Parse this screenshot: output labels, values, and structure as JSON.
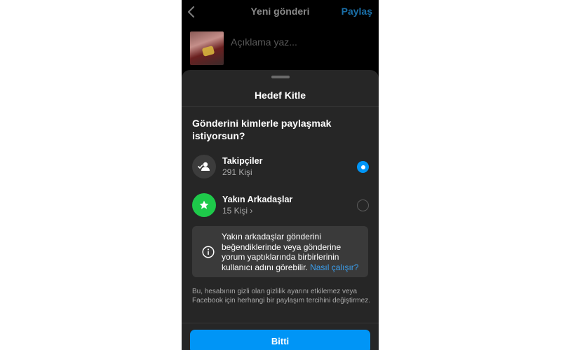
{
  "header": {
    "title": "Yeni gönderi",
    "share_label": "Paylaş"
  },
  "composer": {
    "caption_placeholder": "Açıklama yaz..."
  },
  "sheet": {
    "title": "Hedef Kitle",
    "question": "Gönderini kimlerle paylaşmak istiyorsun?",
    "options": [
      {
        "title": "Takipçiler",
        "subtitle": "291 Kişi",
        "selected": true,
        "icon": "followers-icon"
      },
      {
        "title": "Yakın Arkadaşlar",
        "subtitle": "15 Kişi ›",
        "selected": false,
        "icon": "star-icon"
      }
    ],
    "info": {
      "text": "Yakın arkadaşlar gönderini beğendiklerinde veya gönderine yorum yaptıklarında birbirlerinin kullanıcı adını görebilir.",
      "link": "Nasıl çalışır?"
    },
    "footnote": "Bu, hesabının gizli olan gizlilik ayarını etkilemez veya Facebook için herhangi bir paylaşım tercihini değiştirmez.",
    "done_label": "Bitti"
  },
  "colors": {
    "accent": "#0095f6",
    "sheet_bg": "#262626",
    "close_friends_green": "#1ec94a",
    "link": "#3aa0f0"
  }
}
